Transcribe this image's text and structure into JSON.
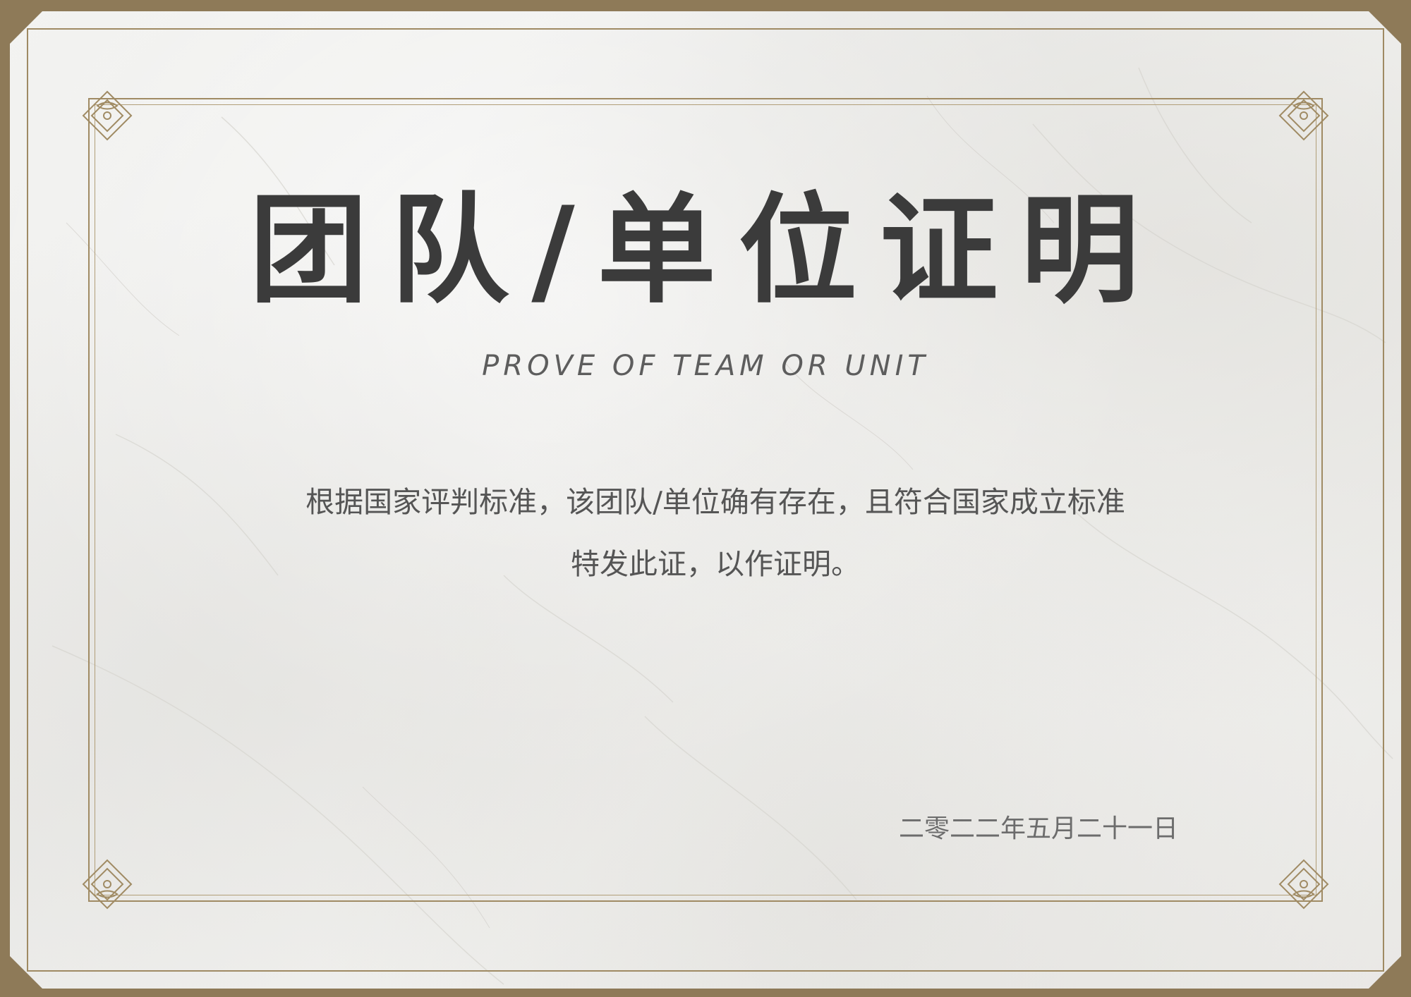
{
  "certificate": {
    "title": "团队/单位证明",
    "subtitle": "PROVE OF TEAM OR UNIT",
    "body_line_1": "根据国家评判标准，该团队/单位确有存在，且符合国家成立标准",
    "body_line_2": "特发此证，以作证明。",
    "date": "二零二二年五月二十一日"
  },
  "colors": {
    "outer_border": "#8e7a58",
    "frame_gold": "#a08b64",
    "title": "#3b3b3b",
    "text": "#555555"
  },
  "icons": {
    "corner_ornament": "filigree-corner-icon"
  }
}
